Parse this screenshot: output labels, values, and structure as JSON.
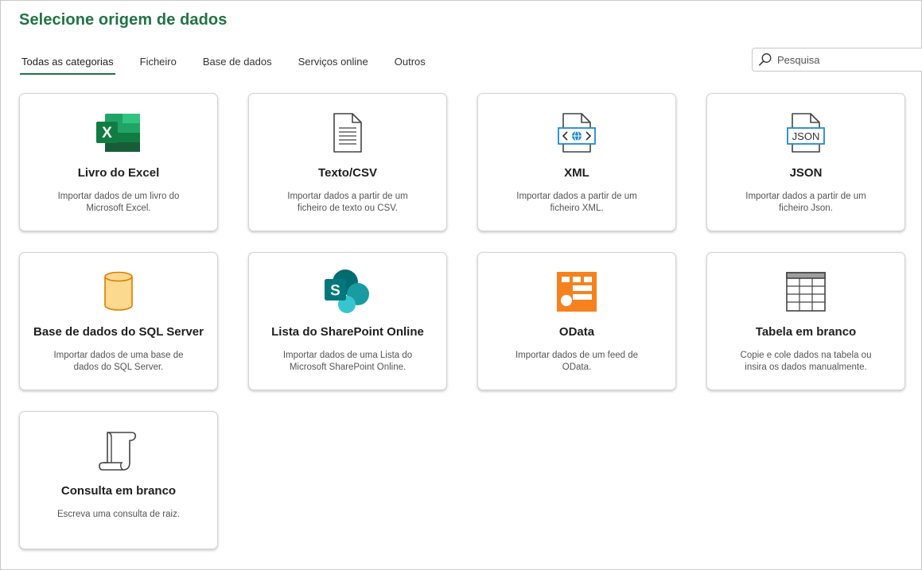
{
  "header": {
    "title": "Selecione origem de dados"
  },
  "tabs": [
    {
      "label": "Todas as categorias",
      "active": true
    },
    {
      "label": "Ficheiro"
    },
    {
      "label": "Base de dados"
    },
    {
      "label": "Serviços online"
    },
    {
      "label": "Outros"
    }
  ],
  "search": {
    "placeholder": "Pesquisa",
    "icon": "search-icon"
  },
  "sources": [
    {
      "title": "Livro do Excel",
      "description": "Importar dados de um livro do Microsoft Excel.",
      "icon": "excel-icon"
    },
    {
      "title": "Texto/CSV",
      "description": "Importar dados a partir de um ficheiro de texto ou CSV.",
      "icon": "text-file-icon"
    },
    {
      "title": "XML",
      "description": "Importar dados a partir de um ficheiro XML.",
      "icon": "xml-file-icon"
    },
    {
      "title": "JSON",
      "description": "Importar dados a partir de um ficheiro Json.",
      "icon": "json-file-icon"
    },
    {
      "title": "Base de dados do SQL Server",
      "description": "Importar dados de uma base de dados do SQL Server.",
      "icon": "database-icon"
    },
    {
      "title": "Lista do SharePoint Online",
      "description": "Importar dados de uma Lista do Microsoft SharePoint Online.",
      "icon": "sharepoint-icon"
    },
    {
      "title": "OData",
      "description": "Importar dados de um feed de OData.",
      "icon": "odata-icon"
    },
    {
      "title": "Tabela em branco",
      "description": "Copie e cole dados na tabela ou insira os dados manualmente.",
      "icon": "table-icon"
    },
    {
      "title": "Consulta em branco",
      "description": "Escreva uma consulta de raiz.",
      "icon": "scroll-icon"
    }
  ],
  "colors": {
    "accent": "#217346",
    "odata": "#F5821F",
    "sharepoint": "#038387",
    "xml_blue": "#1E8BD3"
  }
}
